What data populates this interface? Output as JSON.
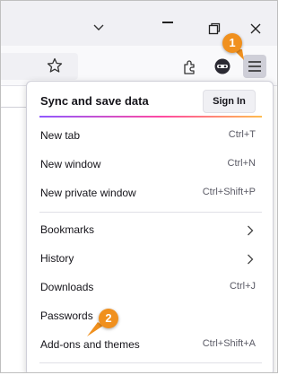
{
  "window": {
    "controls": [
      "chevron-down-icon",
      "minimize-icon",
      "restore-icon",
      "close-icon"
    ]
  },
  "toolbar": {
    "icons": [
      "star-icon",
      "extensions-icon",
      "account-icon",
      "hamburger-menu-icon"
    ]
  },
  "menu": {
    "sync": {
      "label": "Sync and save data",
      "button": "Sign In"
    },
    "groups": [
      [
        {
          "label": "New tab",
          "shortcut": "Ctrl+T"
        },
        {
          "label": "New window",
          "shortcut": "Ctrl+N"
        },
        {
          "label": "New private window",
          "shortcut": "Ctrl+Shift+P"
        }
      ],
      [
        {
          "label": "Bookmarks",
          "shortcut": ""
        },
        {
          "label": "History",
          "shortcut": ""
        },
        {
          "label": "Downloads",
          "shortcut": "Ctrl+J"
        },
        {
          "label": "Passwords",
          "shortcut": ""
        },
        {
          "label": "Add-ons and themes",
          "shortcut": "Ctrl+Shift+A"
        }
      ]
    ]
  },
  "callouts": [
    "1",
    "2"
  ],
  "colors": {
    "callout": "#f0901e",
    "accent_start": "#9059ff",
    "accent_mid": "#ff4aa2",
    "accent_end": "#ffbd4f"
  }
}
